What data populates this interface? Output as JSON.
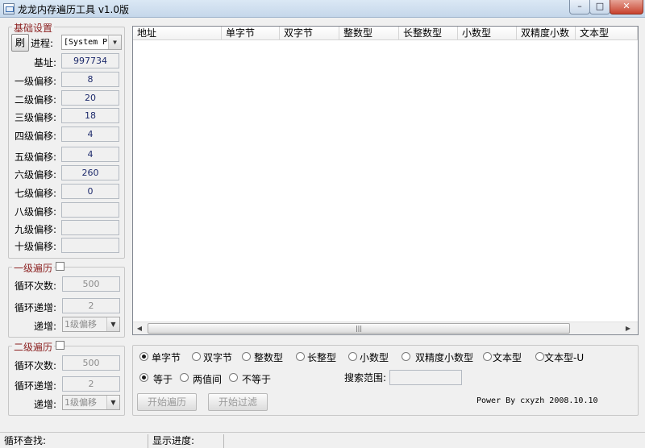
{
  "window": {
    "title": "龙龙内存遍历工具 v1.0版",
    "min": "–",
    "max": "□",
    "close": "✕"
  },
  "basic": {
    "title": "基础设置",
    "refresh": "刷",
    "process_label": "进程:",
    "process_value": "[System Pr",
    "base_label": "基址:",
    "base_value": "997734",
    "offsets": [
      {
        "label": "一级偏移:",
        "value": "8"
      },
      {
        "label": "二级偏移:",
        "value": "20"
      },
      {
        "label": "三级偏移:",
        "value": "18"
      },
      {
        "label": "四级偏移:",
        "value": "4"
      },
      {
        "label": "五级偏移:",
        "value": "4"
      },
      {
        "label": "六级偏移:",
        "value": "260"
      },
      {
        "label": "七级偏移:",
        "value": "0"
      },
      {
        "label": "八级偏移:",
        "value": ""
      },
      {
        "label": "九级偏移:",
        "value": ""
      },
      {
        "label": "十级偏移:",
        "value": ""
      }
    ]
  },
  "level1": {
    "title": "一级遍历",
    "loop_label": "循环次数:",
    "loop_value": "500",
    "step_label": "循环递增:",
    "step_value": "2",
    "inc_label": "递增:",
    "inc_value": "1级偏移"
  },
  "level2": {
    "title": "二级遍历",
    "loop_label": "循环次数:",
    "loop_value": "500",
    "step_label": "循环递增:",
    "step_value": "2",
    "inc_label": "递增:",
    "inc_value": "1级偏移"
  },
  "list": {
    "columns": [
      "地址",
      "单字节",
      "双字节",
      "整数型",
      "长整数型",
      "小数型",
      "双精度小数",
      "文本型"
    ]
  },
  "types": [
    "单字节",
    "双字节",
    "整数型",
    "长整型",
    "小数型",
    "双精度小数型",
    "文本型",
    "文本型-U"
  ],
  "compare": [
    "等于",
    "两值间",
    "不等于"
  ],
  "search_label": "搜索范围:",
  "search_value": "",
  "start_button": "开始遍历",
  "filter_button": "开始过滤",
  "credit": "Power By cxyzh 2008.10.10",
  "status": {
    "loop": "循环查找:",
    "progress": "显示进度:"
  }
}
